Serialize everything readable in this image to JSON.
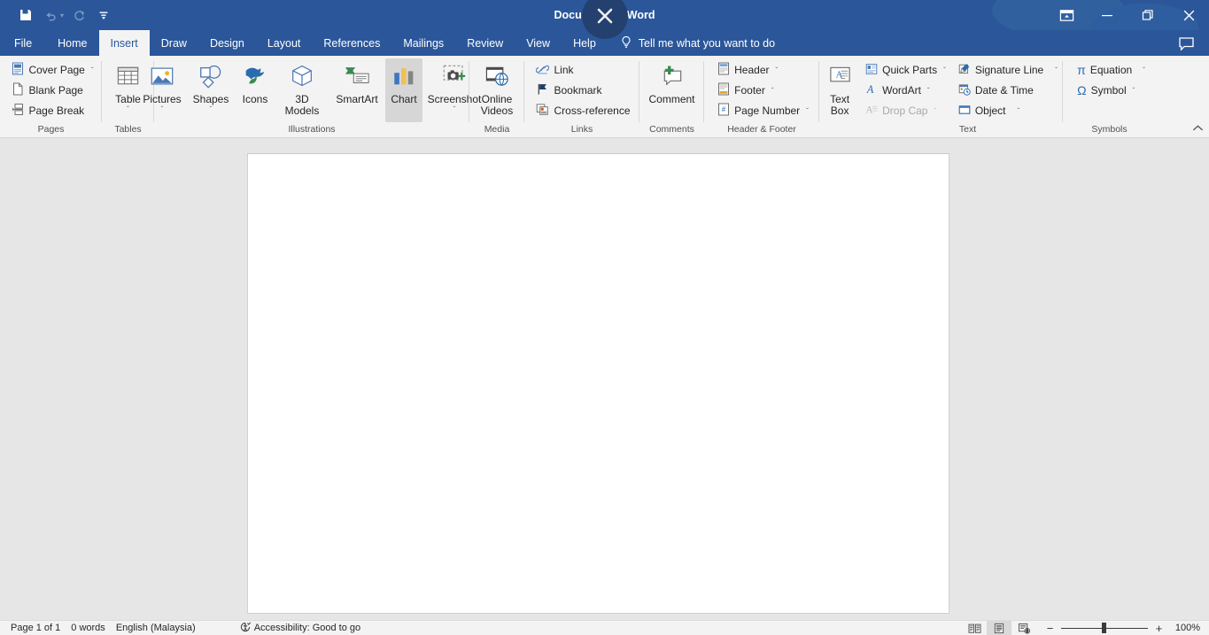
{
  "window": {
    "title_doc": "Document1",
    "title_sep": "-",
    "title_app": "Word",
    "ribbon_display_options": "ribbon-display-options-icon",
    "minimize": "minimize-icon",
    "restore": "restore-icon",
    "close": "close-icon"
  },
  "quick_access": {
    "save": "save-icon",
    "undo": "undo-icon",
    "redo": "redo-icon",
    "customize": "customize-quick-access-toolbar-icon"
  },
  "tabs": [
    {
      "label": "File",
      "active": false
    },
    {
      "label": "Home",
      "active": false
    },
    {
      "label": "Insert",
      "active": true
    },
    {
      "label": "Draw",
      "active": false
    },
    {
      "label": "Design",
      "active": false
    },
    {
      "label": "Layout",
      "active": false
    },
    {
      "label": "References",
      "active": false
    },
    {
      "label": "Mailings",
      "active": false
    },
    {
      "label": "Review",
      "active": false
    },
    {
      "label": "View",
      "active": false
    },
    {
      "label": "Help",
      "active": false
    }
  ],
  "tellme": {
    "label": "Tell me what you want to do",
    "icon": "lightbulb-icon"
  },
  "comments": {
    "label": "Comments",
    "icon": "comment-icon"
  },
  "ribbon": {
    "collapse": "collapse-ribbon-chevron-icon",
    "groups": [
      {
        "name": "Pages",
        "label": "Pages",
        "items": [
          {
            "label": "Cover Page",
            "caret": "ˇ",
            "disabled": false
          },
          {
            "label": "Blank Page",
            "caret": "",
            "disabled": false
          },
          {
            "label": "Page Break",
            "caret": "",
            "disabled": false
          }
        ]
      },
      {
        "name": "Tables",
        "label": "Tables",
        "big": [
          {
            "label": "Table",
            "caret": "ˇ",
            "hot": false
          }
        ]
      },
      {
        "name": "Illustrations",
        "label": "Illustrations",
        "big": [
          {
            "label": "Pictures",
            "caret": "ˇ",
            "hot": false
          },
          {
            "label": "Shapes",
            "caret": "ˇ",
            "hot": false
          },
          {
            "label": "Icons",
            "caret": "",
            "hot": false
          },
          {
            "label": "3D Models",
            "caret": "ˇ",
            "hot": false
          },
          {
            "label": "SmartArt",
            "caret": "",
            "hot": false
          },
          {
            "label": "Chart",
            "caret": "",
            "hot": true
          },
          {
            "label": "Screenshot",
            "caret": "ˇ",
            "hot": false
          }
        ]
      },
      {
        "name": "Media",
        "label": "Media",
        "big": [
          {
            "label": "Online Videos",
            "caret": "",
            "hot": false
          }
        ]
      },
      {
        "name": "Links",
        "label": "Links",
        "items": [
          {
            "label": "Link",
            "caret": "",
            "disabled": false
          },
          {
            "label": "Bookmark",
            "caret": "",
            "disabled": false
          },
          {
            "label": "Cross-reference",
            "caret": "",
            "disabled": false
          }
        ]
      },
      {
        "name": "Comments",
        "label": "Comments",
        "big": [
          {
            "label": "Comment",
            "caret": "",
            "hot": false
          }
        ]
      },
      {
        "name": "HeaderFooter",
        "label": "Header & Footer",
        "items": [
          {
            "label": "Header",
            "caret": "ˇ",
            "disabled": false
          },
          {
            "label": "Footer",
            "caret": "ˇ",
            "disabled": false
          },
          {
            "label": "Page Number",
            "caret": "ˇ",
            "disabled": false
          }
        ]
      },
      {
        "name": "Text",
        "label": "Text",
        "big": [
          {
            "label": "Text Box",
            "caret": "ˇ",
            "hot": false
          }
        ],
        "col1": [
          {
            "label": "Quick Parts",
            "caret": "ˇ",
            "disabled": false
          },
          {
            "label": "WordArt",
            "caret": "ˇ",
            "disabled": false
          },
          {
            "label": "Drop Cap",
            "caret": "ˇ",
            "disabled": true
          }
        ],
        "col2": [
          {
            "label": "Signature Line",
            "caret": "ˇ",
            "disabled": false
          },
          {
            "label": "Date & Time",
            "caret": "",
            "disabled": false
          },
          {
            "label": "Object",
            "caret": "ˇ",
            "disabled": false
          }
        ]
      },
      {
        "name": "Symbols",
        "label": "Symbols",
        "items": [
          {
            "label": "Equation",
            "caret": "ˇ",
            "disabled": false
          },
          {
            "label": "Symbol",
            "caret": "ˇ",
            "disabled": false
          }
        ]
      }
    ]
  },
  "status": {
    "page": "Page 1 of 1",
    "words": "0 words",
    "language": "English (Malaysia)",
    "accessibility": "Accessibility: Good to go",
    "accessibility_icon": "accessibility-icon",
    "views": [
      {
        "name": "read-mode",
        "active": false
      },
      {
        "name": "print-layout",
        "active": true
      },
      {
        "name": "web-layout",
        "active": false
      }
    ],
    "zoom_out": "−",
    "zoom_in": "+",
    "zoom_value": "100%"
  },
  "colors": {
    "brand": "#2b579a",
    "ribbon_bg": "#f3f3f3",
    "canvas_bg": "#e6e6e6",
    "page_bg": "#ffffff",
    "hover": "#d6d6d6"
  }
}
